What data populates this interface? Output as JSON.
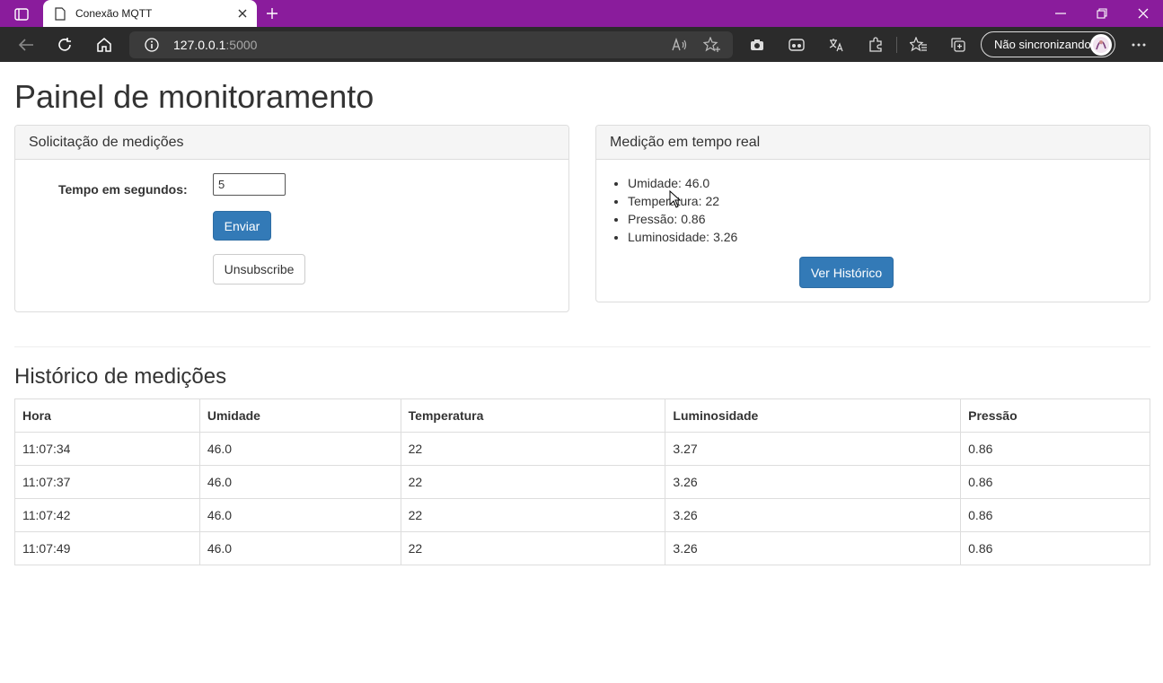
{
  "browser": {
    "tab_title": "Conexão MQTT",
    "url_host": "127.0.0.1",
    "url_port": ":5000",
    "sync_label": "Não sincronizando",
    "colors": {
      "titlebar": "#8a1c9c",
      "toolbar": "#2b2b2b"
    }
  },
  "page": {
    "title": "Painel de monitoramento",
    "request_panel": {
      "heading": "Solicitação de medições",
      "time_label": "Tempo em segundos:",
      "time_value": "5",
      "send_label": "Enviar",
      "unsubscribe_label": "Unsubscribe"
    },
    "realtime_panel": {
      "heading": "Medição em tempo real",
      "readings": [
        {
          "label": "Umidade:",
          "value": "46.0"
        },
        {
          "label": "Temperatura:",
          "value": "22"
        },
        {
          "label": "Pressão:",
          "value": "0.86"
        },
        {
          "label": "Luminosidade:",
          "value": "3.26"
        }
      ],
      "history_button_label": "Ver Histórico"
    },
    "history": {
      "title": "Histórico de medições",
      "columns": [
        "Hora",
        "Umidade",
        "Temperatura",
        "Luminosidade",
        "Pressão"
      ],
      "rows": [
        [
          "11:07:34",
          "46.0",
          "22",
          "3.27",
          "0.86"
        ],
        [
          "11:07:37",
          "46.0",
          "22",
          "3.26",
          "0.86"
        ],
        [
          "11:07:42",
          "46.0",
          "22",
          "3.26",
          "0.86"
        ],
        [
          "11:07:49",
          "46.0",
          "22",
          "3.26",
          "0.86"
        ]
      ]
    },
    "colors": {
      "primary_button": "#337ab7"
    }
  }
}
